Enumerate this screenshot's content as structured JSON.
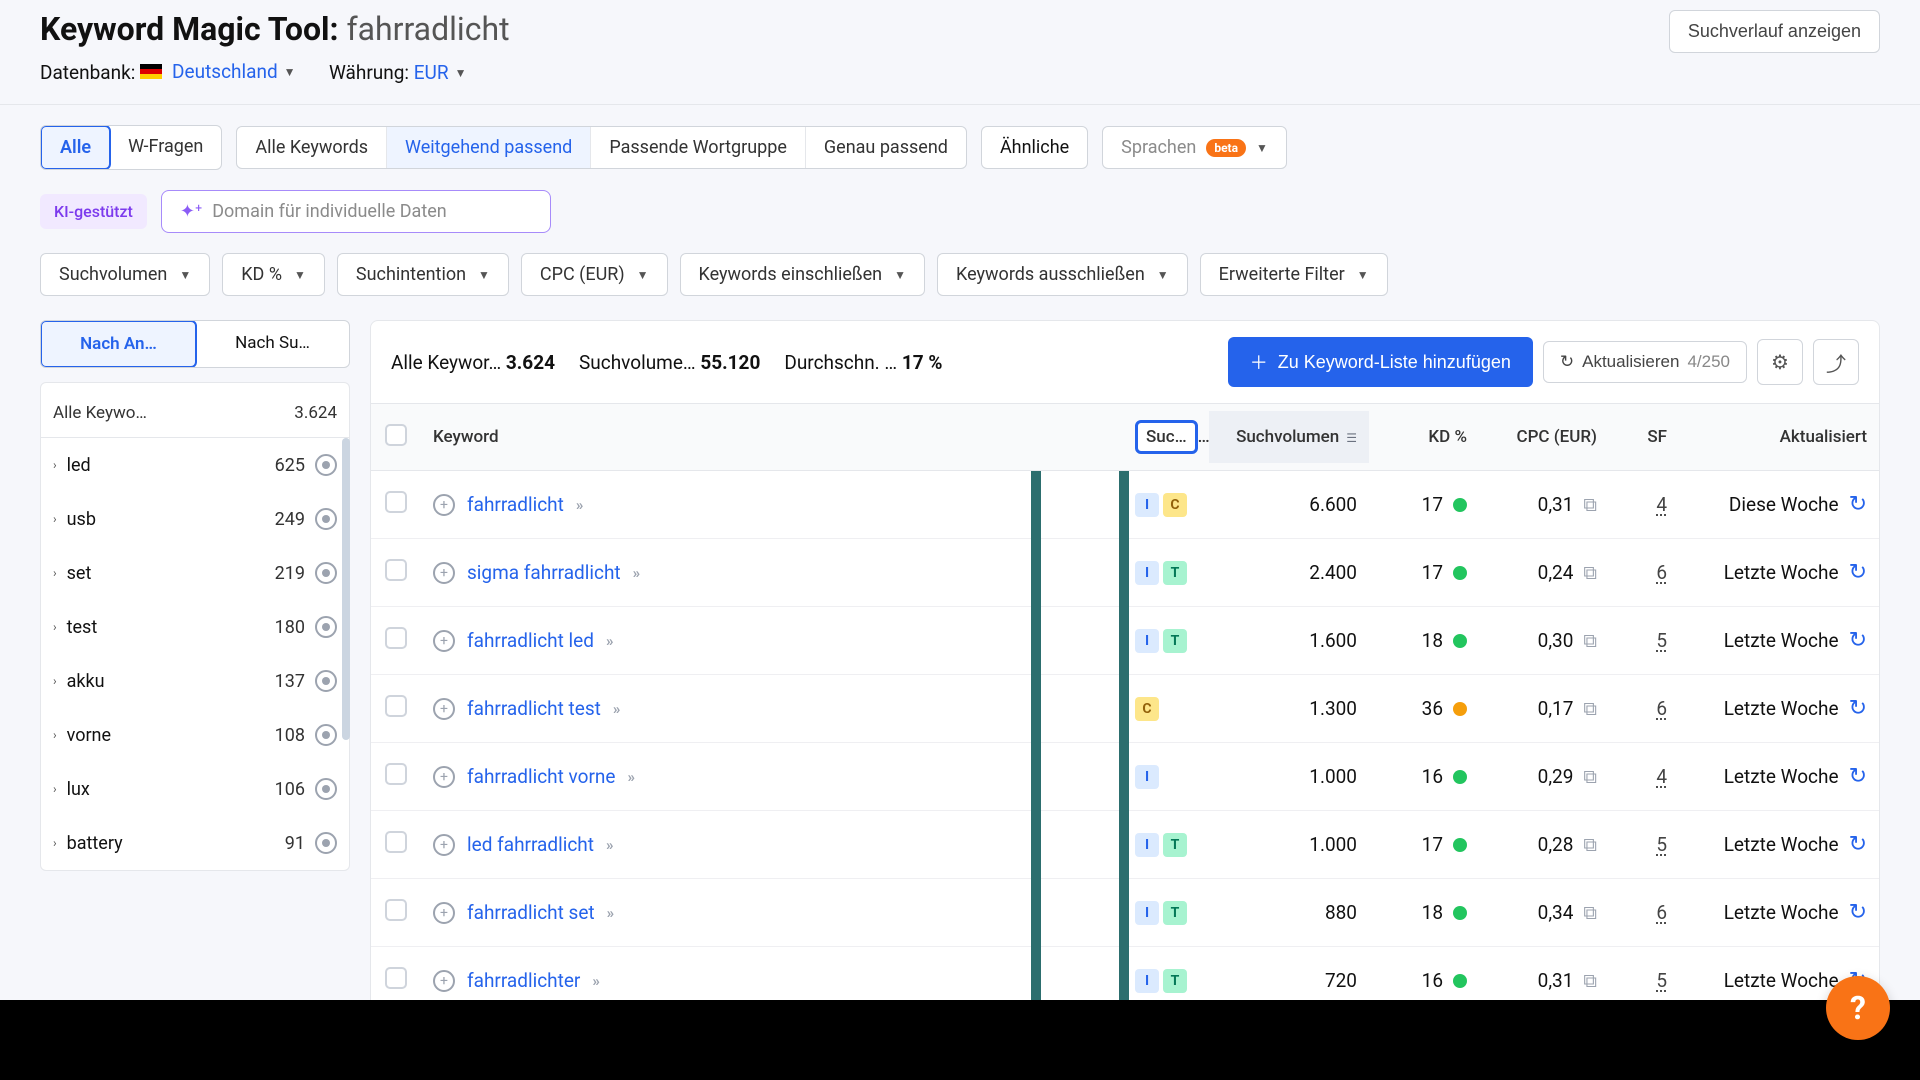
{
  "header": {
    "title": "Keyword Magic Tool:",
    "term": "fahrradlicht",
    "db_label": "Datenbank:",
    "db_value": "Deutschland",
    "currency_label": "Währung:",
    "currency_value": "EUR",
    "history_btn": "Suchverlauf anzeigen"
  },
  "tabs": {
    "group1": [
      "Alle",
      "W-Fragen"
    ],
    "group2": [
      "Alle Keywords",
      "Weitgehend passend",
      "Passende Wortgruppe",
      "Genau passend"
    ],
    "similar": "Ähnliche",
    "languages": "Sprachen",
    "beta": "beta"
  },
  "ki": {
    "label": "KI-gestützt",
    "placeholder": "Domain für individuelle Daten"
  },
  "filters": [
    "Suchvolumen",
    "KD %",
    "Suchintention",
    "CPC (EUR)",
    "Keywords einschließen",
    "Keywords ausschließen",
    "Erweiterte Filter"
  ],
  "sidebar": {
    "seg": [
      "Nach An…",
      "Nach Su…"
    ],
    "all_label": "Alle Keywo…",
    "all_count": "3.624",
    "items": [
      {
        "label": "led",
        "count": "625"
      },
      {
        "label": "usb",
        "count": "249"
      },
      {
        "label": "set",
        "count": "219"
      },
      {
        "label": "test",
        "count": "180"
      },
      {
        "label": "akku",
        "count": "137"
      },
      {
        "label": "vorne",
        "count": "108"
      },
      {
        "label": "lux",
        "count": "106"
      },
      {
        "label": "battery",
        "count": "91"
      }
    ]
  },
  "summary": {
    "s1_label": "Alle Keywor…",
    "s1_val": "3.624",
    "s2_label": "Suchvolume…",
    "s2_val": "55.120",
    "s3_label": "Durchschn. …",
    "s3_val": "17 %",
    "add_btn": "Zu Keyword-Liste hinzufügen",
    "refresh_btn": "Aktualisieren",
    "count": "4/250"
  },
  "columns": {
    "keyword": "Keyword",
    "intent": "Suc…",
    "volume": "Suchvolumen",
    "kd": "KD %",
    "cpc": "CPC (EUR)",
    "sf": "SF",
    "updated": "Aktualisiert"
  },
  "rows": [
    {
      "kw": "fahrradlicht",
      "intents": [
        "I",
        "C"
      ],
      "vol": "6.600",
      "kd": "17",
      "kd_color": "green",
      "cpc": "0,31",
      "sf": "4",
      "upd": "Diese Woche"
    },
    {
      "kw": "sigma fahrradlicht",
      "intents": [
        "I",
        "T"
      ],
      "vol": "2.400",
      "kd": "17",
      "kd_color": "green",
      "cpc": "0,24",
      "sf": "6",
      "upd": "Letzte Woche"
    },
    {
      "kw": "fahrradlicht led",
      "intents": [
        "I",
        "T"
      ],
      "vol": "1.600",
      "kd": "18",
      "kd_color": "green",
      "cpc": "0,30",
      "sf": "5",
      "upd": "Letzte Woche"
    },
    {
      "kw": "fahrradlicht test",
      "intents": [
        "C"
      ],
      "vol": "1.300",
      "kd": "36",
      "kd_color": "yellow",
      "cpc": "0,17",
      "sf": "6",
      "upd": "Letzte Woche"
    },
    {
      "kw": "fahrradlicht vorne",
      "intents": [
        "I"
      ],
      "vol": "1.000",
      "kd": "16",
      "kd_color": "green",
      "cpc": "0,29",
      "sf": "4",
      "upd": "Letzte Woche"
    },
    {
      "kw": "led fahrradlicht",
      "intents": [
        "I",
        "T"
      ],
      "vol": "1.000",
      "kd": "17",
      "kd_color": "green",
      "cpc": "0,28",
      "sf": "5",
      "upd": "Letzte Woche"
    },
    {
      "kw": "fahrradlicht set",
      "intents": [
        "I",
        "T"
      ],
      "vol": "880",
      "kd": "18",
      "kd_color": "green",
      "cpc": "0,34",
      "sf": "6",
      "upd": "Letzte Woche"
    },
    {
      "kw": "fahrradlichter",
      "intents": [
        "I",
        "T"
      ],
      "vol": "720",
      "kd": "16",
      "kd_color": "green",
      "cpc": "0,31",
      "sf": "5",
      "upd": "Letzte Woche"
    }
  ]
}
